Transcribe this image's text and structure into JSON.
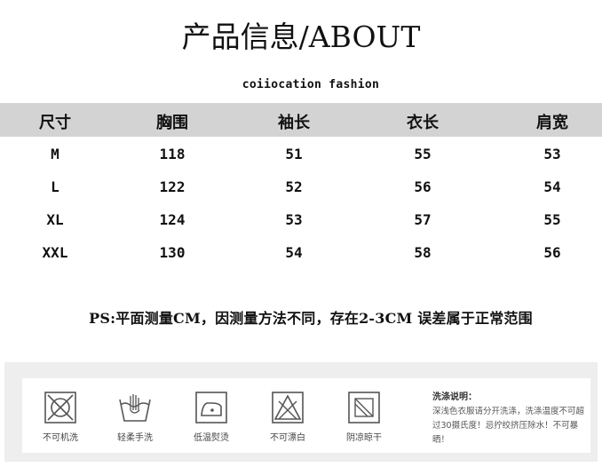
{
  "title": "产品信息/ABOUT",
  "brand": "coiiocation fashion",
  "table": {
    "headers": [
      "尺寸",
      "胸围",
      "袖长",
      "衣长",
      "肩宽"
    ],
    "rows": [
      [
        "M",
        "118",
        "51",
        "55",
        "53"
      ],
      [
        "L",
        "122",
        "52",
        "56",
        "54"
      ],
      [
        "XL",
        "124",
        "53",
        "57",
        "55"
      ],
      [
        "XXL",
        "130",
        "54",
        "58",
        "56"
      ]
    ]
  },
  "note": "PS:平面测量CM，因测量方法不同，存在2-3CM 误差属于正常范围",
  "care": {
    "symbols": [
      {
        "icon": "no-machine-wash-icon",
        "label": "不可机洗"
      },
      {
        "icon": "gentle-hand-wash-icon",
        "label": "轻柔手洗"
      },
      {
        "icon": "low-temperature-iron-icon",
        "label": "低温熨烫"
      },
      {
        "icon": "no-bleach-icon",
        "label": "不可漂白"
      },
      {
        "icon": "shade-dry-icon",
        "label": "阴凉晾干"
      }
    ],
    "wash_title": "洗涤说明：",
    "wash_text": "深浅色衣服请分开洗涤，洗涤温度不可超过30摄氏度！忌拧绞挤压除水！不可暴晒！"
  }
}
